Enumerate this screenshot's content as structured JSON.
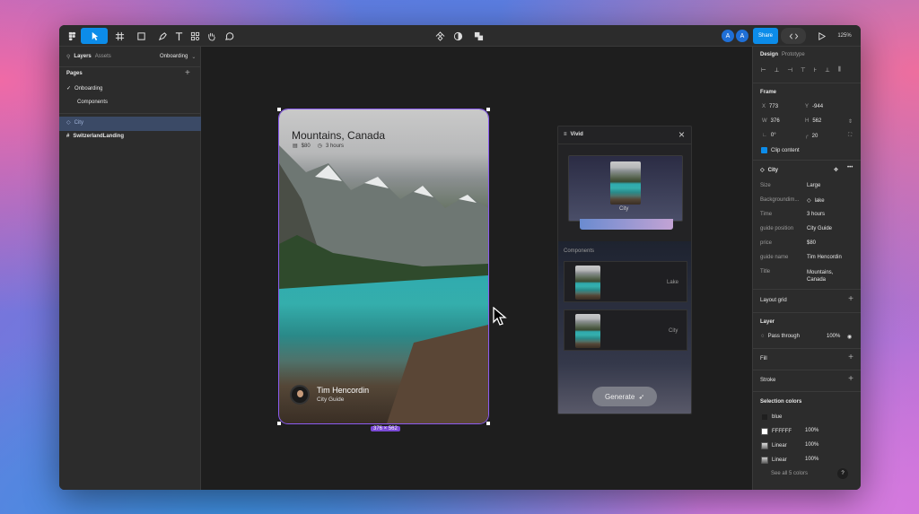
{
  "toolbar": {
    "share": "Share",
    "zoom": "125%",
    "avatar1": "A",
    "avatar2": "A"
  },
  "left": {
    "tabs": [
      "Layers",
      "Assets"
    ],
    "page_select": "Onboarding",
    "pages_header": "Pages",
    "pages": [
      {
        "label": "Onboarding",
        "checked": true
      },
      {
        "label": "Components",
        "checked": false
      }
    ],
    "layers": [
      {
        "label": "City",
        "selected": true
      },
      {
        "label": "SwitzerlandLanding",
        "selected": false
      }
    ]
  },
  "card": {
    "title": "Mountains, Canada",
    "price": "$80",
    "time": "3 hours",
    "guide_name": "Tim Hencordin",
    "guide_role": "City Guide",
    "size_badge": "376 × 562"
  },
  "vivid": {
    "title": "Vivid",
    "preview_label": "City",
    "components_header": "Components",
    "components": [
      {
        "label": "Lake"
      },
      {
        "label": "City"
      }
    ],
    "generate": "Generate"
  },
  "right": {
    "tabs": [
      "Design",
      "Prototype"
    ],
    "frame": {
      "header": "Frame",
      "x": "773",
      "y": "-944",
      "w": "376",
      "h": "562",
      "rotation": "0°",
      "radius": "20",
      "clip": "Clip content"
    },
    "component": {
      "name": "City",
      "props": [
        {
          "k": "Size",
          "v": "Large"
        },
        {
          "k": "Backgroundim...",
          "v": "lake"
        },
        {
          "k": "Time",
          "v": "3 hours"
        },
        {
          "k": "guide position",
          "v": "City Guide"
        },
        {
          "k": "price",
          "v": "$80"
        },
        {
          "k": "guide name",
          "v": "Tim Hencordin"
        },
        {
          "k": "Title",
          "v": "Mountains,\nCanada"
        }
      ]
    },
    "layout_grid": "Layout grid",
    "layer": {
      "header": "Layer",
      "blend": "Pass through",
      "opacity": "100%"
    },
    "fill": "Fill",
    "stroke": "Stroke",
    "selection_colors": {
      "header": "Selection colors",
      "items": [
        {
          "name": "blue",
          "opacity": ""
        },
        {
          "name": "FFFFFF",
          "opacity": "100%"
        },
        {
          "name": "Linear",
          "opacity": "100%"
        },
        {
          "name": "Linear",
          "opacity": "100%"
        }
      ],
      "see_all": "See all 5 colors"
    },
    "help": "?"
  }
}
